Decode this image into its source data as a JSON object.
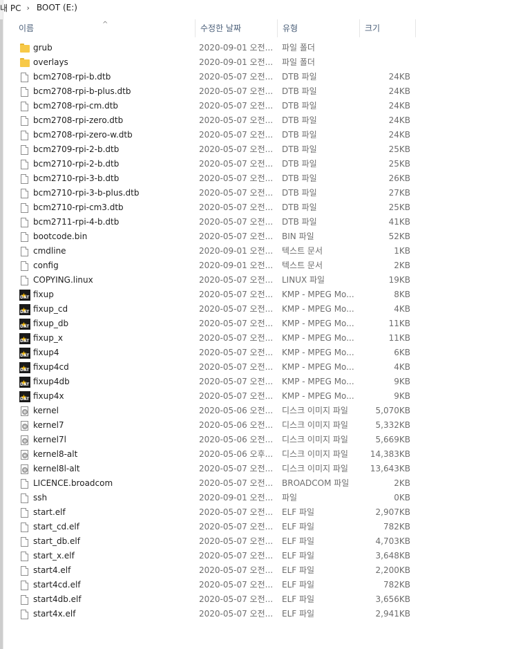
{
  "breadcrumb": {
    "part1": "내 PC",
    "sep": "›",
    "part2": "BOOT (E:)"
  },
  "columns": {
    "name": "이름",
    "date": "수정한 날짜",
    "type": "유형",
    "size": "크기",
    "sort_indicator": "^"
  },
  "icons": {
    "folder": "folder-icon",
    "file": "file-icon",
    "dat": "dat-file-icon",
    "disc": "disc-image-icon"
  },
  "files": [
    {
      "icon": "folder",
      "name": "grub",
      "date": "2020-09-01 오전...",
      "type": "파일 폴더",
      "size": ""
    },
    {
      "icon": "folder",
      "name": "overlays",
      "date": "2020-09-01 오전...",
      "type": "파일 폴더",
      "size": ""
    },
    {
      "icon": "file",
      "name": "bcm2708-rpi-b.dtb",
      "date": "2020-05-07 오전...",
      "type": "DTB 파일",
      "size": "24KB"
    },
    {
      "icon": "file",
      "name": "bcm2708-rpi-b-plus.dtb",
      "date": "2020-05-07 오전...",
      "type": "DTB 파일",
      "size": "24KB"
    },
    {
      "icon": "file",
      "name": "bcm2708-rpi-cm.dtb",
      "date": "2020-05-07 오전...",
      "type": "DTB 파일",
      "size": "24KB"
    },
    {
      "icon": "file",
      "name": "bcm2708-rpi-zero.dtb",
      "date": "2020-05-07 오전...",
      "type": "DTB 파일",
      "size": "24KB"
    },
    {
      "icon": "file",
      "name": "bcm2708-rpi-zero-w.dtb",
      "date": "2020-05-07 오전...",
      "type": "DTB 파일",
      "size": "24KB"
    },
    {
      "icon": "file",
      "name": "bcm2709-rpi-2-b.dtb",
      "date": "2020-05-07 오전...",
      "type": "DTB 파일",
      "size": "25KB"
    },
    {
      "icon": "file",
      "name": "bcm2710-rpi-2-b.dtb",
      "date": "2020-05-07 오전...",
      "type": "DTB 파일",
      "size": "25KB"
    },
    {
      "icon": "file",
      "name": "bcm2710-rpi-3-b.dtb",
      "date": "2020-05-07 오전...",
      "type": "DTB 파일",
      "size": "26KB"
    },
    {
      "icon": "file",
      "name": "bcm2710-rpi-3-b-plus.dtb",
      "date": "2020-05-07 오전...",
      "type": "DTB 파일",
      "size": "27KB"
    },
    {
      "icon": "file",
      "name": "bcm2710-rpi-cm3.dtb",
      "date": "2020-05-07 오전...",
      "type": "DTB 파일",
      "size": "25KB"
    },
    {
      "icon": "file",
      "name": "bcm2711-rpi-4-b.dtb",
      "date": "2020-05-07 오전...",
      "type": "DTB 파일",
      "size": "41KB"
    },
    {
      "icon": "file",
      "name": "bootcode.bin",
      "date": "2020-05-07 오전...",
      "type": "BIN 파일",
      "size": "52KB"
    },
    {
      "icon": "file",
      "name": "cmdline",
      "date": "2020-09-01 오전...",
      "type": "텍스트 문서",
      "size": "1KB"
    },
    {
      "icon": "file",
      "name": "config",
      "date": "2020-09-01 오전...",
      "type": "텍스트 문서",
      "size": "2KB"
    },
    {
      "icon": "file",
      "name": "COPYING.linux",
      "date": "2020-05-07 오전...",
      "type": "LINUX 파일",
      "size": "19KB"
    },
    {
      "icon": "dat",
      "name": "fixup",
      "date": "2020-05-07 오전...",
      "type": "KMP - MPEG Mo...",
      "size": "8KB"
    },
    {
      "icon": "dat",
      "name": "fixup_cd",
      "date": "2020-05-07 오전...",
      "type": "KMP - MPEG Mo...",
      "size": "4KB"
    },
    {
      "icon": "dat",
      "name": "fixup_db",
      "date": "2020-05-07 오전...",
      "type": "KMP - MPEG Mo...",
      "size": "11KB"
    },
    {
      "icon": "dat",
      "name": "fixup_x",
      "date": "2020-05-07 오전...",
      "type": "KMP - MPEG Mo...",
      "size": "11KB"
    },
    {
      "icon": "dat",
      "name": "fixup4",
      "date": "2020-05-07 오전...",
      "type": "KMP - MPEG Mo...",
      "size": "6KB"
    },
    {
      "icon": "dat",
      "name": "fixup4cd",
      "date": "2020-05-07 오전...",
      "type": "KMP - MPEG Mo...",
      "size": "4KB"
    },
    {
      "icon": "dat",
      "name": "fixup4db",
      "date": "2020-05-07 오전...",
      "type": "KMP - MPEG Mo...",
      "size": "9KB"
    },
    {
      "icon": "dat",
      "name": "fixup4x",
      "date": "2020-05-07 오전...",
      "type": "KMP - MPEG Mo...",
      "size": "9KB"
    },
    {
      "icon": "disc",
      "name": "kernel",
      "date": "2020-05-06 오전...",
      "type": "디스크 이미지 파일",
      "size": "5,070KB"
    },
    {
      "icon": "disc",
      "name": "kernel7",
      "date": "2020-05-06 오전...",
      "type": "디스크 이미지 파일",
      "size": "5,332KB"
    },
    {
      "icon": "disc",
      "name": "kernel7l",
      "date": "2020-05-06 오전...",
      "type": "디스크 이미지 파일",
      "size": "5,669KB"
    },
    {
      "icon": "disc",
      "name": "kernel8-alt",
      "date": "2020-05-06 오후...",
      "type": "디스크 이미지 파일",
      "size": "14,383KB"
    },
    {
      "icon": "disc",
      "name": "kernel8l-alt",
      "date": "2020-05-07 오전...",
      "type": "디스크 이미지 파일",
      "size": "13,643KB"
    },
    {
      "icon": "file",
      "name": "LICENCE.broadcom",
      "date": "2020-05-07 오전...",
      "type": "BROADCOM 파일",
      "size": "2KB"
    },
    {
      "icon": "file",
      "name": "ssh",
      "date": "2020-09-01 오전...",
      "type": "파일",
      "size": "0KB"
    },
    {
      "icon": "file",
      "name": "start.elf",
      "date": "2020-05-07 오전...",
      "type": "ELF 파일",
      "size": "2,907KB"
    },
    {
      "icon": "file",
      "name": "start_cd.elf",
      "date": "2020-05-07 오전...",
      "type": "ELF 파일",
      "size": "782KB"
    },
    {
      "icon": "file",
      "name": "start_db.elf",
      "date": "2020-05-07 오전...",
      "type": "ELF 파일",
      "size": "4,703KB"
    },
    {
      "icon": "file",
      "name": "start_x.elf",
      "date": "2020-05-07 오전...",
      "type": "ELF 파일",
      "size": "3,648KB"
    },
    {
      "icon": "file",
      "name": "start4.elf",
      "date": "2020-05-07 오전...",
      "type": "ELF 파일",
      "size": "2,200KB"
    },
    {
      "icon": "file",
      "name": "start4cd.elf",
      "date": "2020-05-07 오전...",
      "type": "ELF 파일",
      "size": "782KB"
    },
    {
      "icon": "file",
      "name": "start4db.elf",
      "date": "2020-05-07 오전...",
      "type": "ELF 파일",
      "size": "3,656KB"
    },
    {
      "icon": "file",
      "name": "start4x.elf",
      "date": "2020-05-07 오전...",
      "type": "ELF 파일",
      "size": "2,941KB"
    }
  ]
}
